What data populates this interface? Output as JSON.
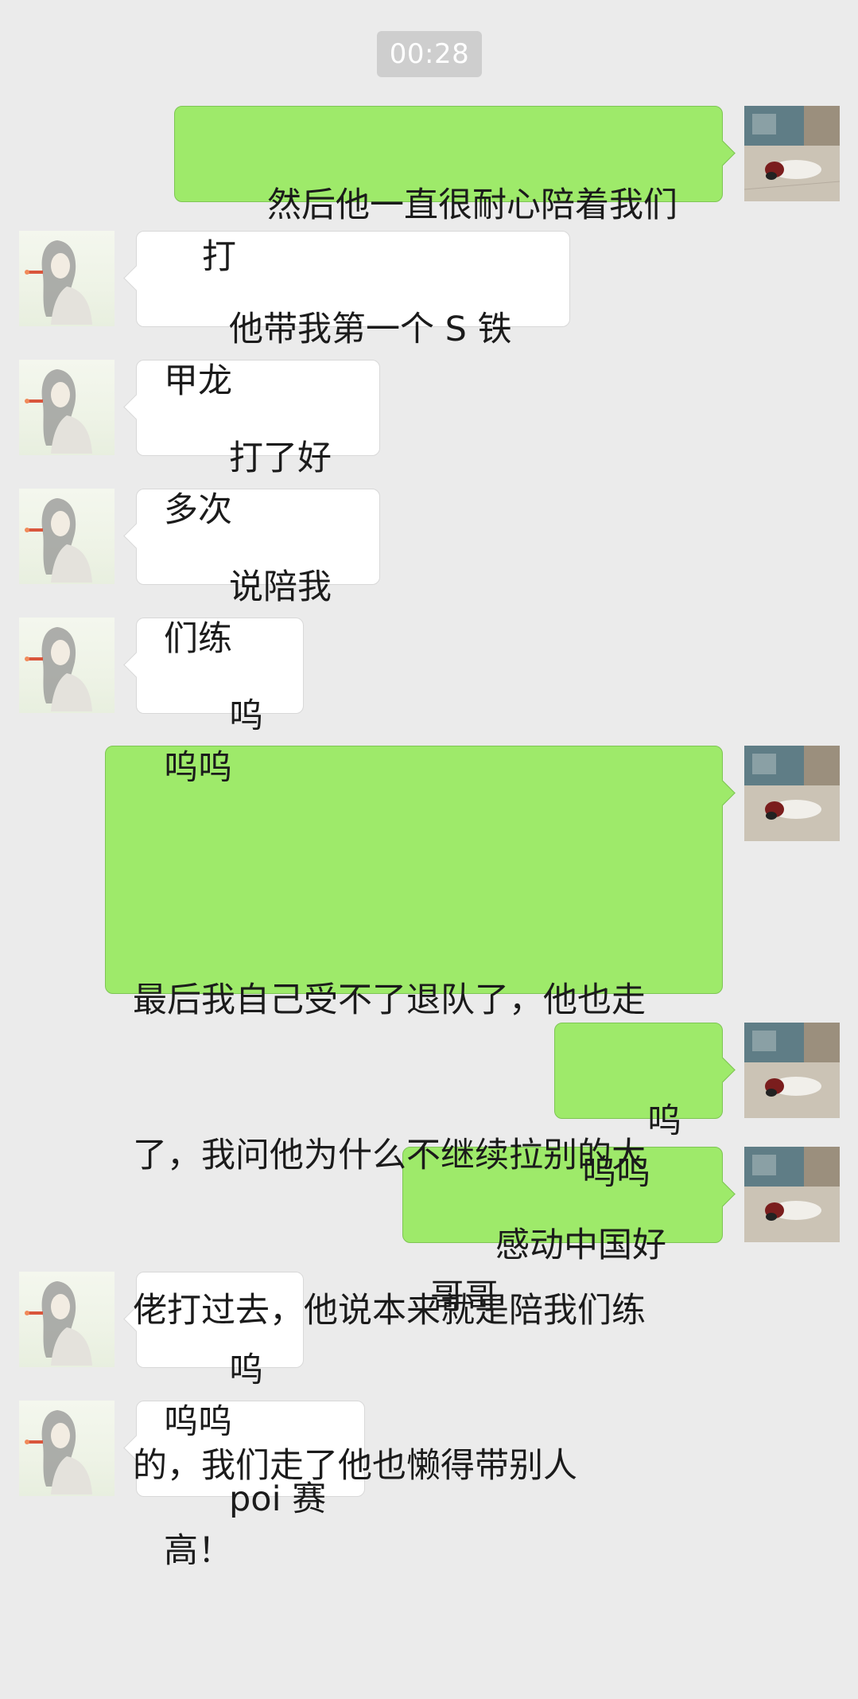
{
  "timestamp": "00:28",
  "messages": [
    {
      "side": "right",
      "text": "然后他一直很耐心陪着我们打"
    },
    {
      "side": "left",
      "text": "他带我第一个 S 铁甲龙"
    },
    {
      "side": "left",
      "text": "打了好多次"
    },
    {
      "side": "left",
      "text": "说陪我们练"
    },
    {
      "side": "left",
      "text": "呜呜呜"
    },
    {
      "side": "right",
      "lines": [
        "最后我自己受不了退队了，他也走",
        "了，我问他为什么不继续拉别的大",
        "佬打过去，他说本来就是陪我们练",
        "的，我们走了他也懒得带别人"
      ]
    },
    {
      "side": "right",
      "text": "呜呜呜"
    },
    {
      "side": "right",
      "text": "感动中国好哥哥"
    },
    {
      "side": "left",
      "text": "呜呜呜"
    },
    {
      "side": "left",
      "text": "poi 赛高！"
    }
  ],
  "colors": {
    "background": "#ebebeb",
    "incoming_bubble": "#ffffff",
    "outgoing_bubble": "#9eea6a",
    "timestamp_bg": "#cecece"
  },
  "icons": {
    "incoming_avatar": "girl-avatar-icon",
    "outgoing_avatar": "dog-photo-avatar-icon"
  }
}
